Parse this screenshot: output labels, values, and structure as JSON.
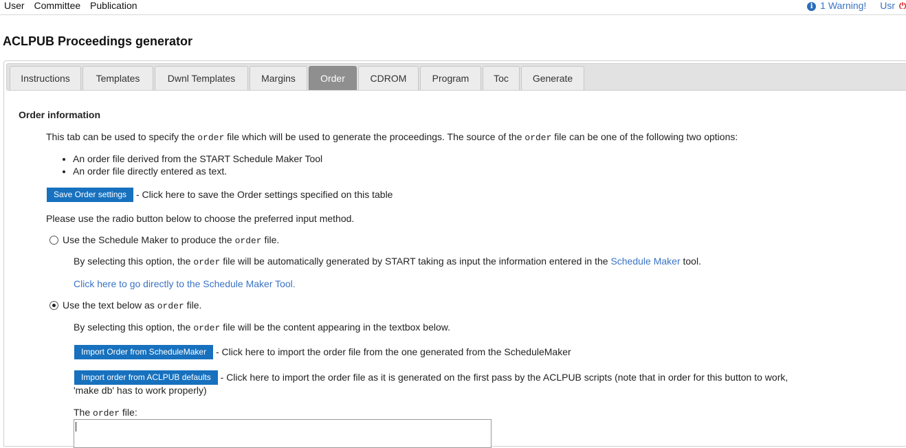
{
  "topbar": {
    "menu": [
      "User",
      "Committee",
      "Publication"
    ],
    "warning": "1 Warning!",
    "user": "Usr",
    "info_icon": "info-icon",
    "power_icon": "power-icon"
  },
  "page_title": "ACLPUB Proceedings generator",
  "tabs": [
    {
      "label": "Instructions",
      "active": false
    },
    {
      "label": "Templates",
      "active": false
    },
    {
      "label": "Dwnl Templates",
      "active": false
    },
    {
      "label": "Margins",
      "active": false
    },
    {
      "label": "Order",
      "active": true
    },
    {
      "label": "CDROM",
      "active": false
    },
    {
      "label": "Program",
      "active": false
    },
    {
      "label": "Toc",
      "active": false
    },
    {
      "label": "Generate",
      "active": false
    }
  ],
  "content": {
    "heading": "Order information",
    "intro": {
      "part1": "This tab can be used to specify the ",
      "code1": "order",
      "part2": " file which will be used to generate the proceedings. The source of the ",
      "code2": "order",
      "part3": " file can be one of the following two options:"
    },
    "options": [
      "An order file derived from the START Schedule Maker Tool",
      "An order file directly entered as text."
    ],
    "save_button": "Save Order settings",
    "save_desc": " - Click here to save the Order settings specified on this table",
    "radio_instruction": "Please use the radio button below to choose the preferred input method.",
    "option_schedule": {
      "label_pre": "Use the Schedule Maker to produce the ",
      "code": "order",
      "label_post": " file.",
      "desc_pre": "By selecting this option, the ",
      "desc_code": "order",
      "desc_mid": " file will be automatically generated by START taking as input the information entered in the ",
      "desc_link": "Schedule Maker",
      "desc_post": " tool.",
      "goto_link": "Click here to go directly to the Schedule Maker Tool."
    },
    "option_text": {
      "label_pre": "Use the text below as ",
      "code": "order",
      "label_post": " file.",
      "desc_pre": "By selecting this option, the ",
      "desc_code": "order",
      "desc_post": " file will be the content appearing in the textbox below.",
      "import_sm_button": "Import Order from ScheduleMaker",
      "import_sm_desc": " - Click here to import the order file from the one generated from the ScheduleMaker",
      "import_acl_button": "Import order from ACLPUB defaults",
      "import_acl_desc_line1": " - Click here to import the order file as it is generated on the first pass by the ACLPUB scripts (note that in order for this button to work,",
      "import_acl_desc_line2": "'make db' has to work properly)",
      "textbox_label_pre": "The ",
      "textbox_label_code": "order",
      "textbox_label_post": " file:",
      "textbox_value": ""
    },
    "selected_option": "text"
  },
  "colors": {
    "button_blue": "#1771be",
    "link_blue": "#3a72c4",
    "active_tab": "#8f8f8f",
    "tab_bar": "#e2e2e2"
  }
}
